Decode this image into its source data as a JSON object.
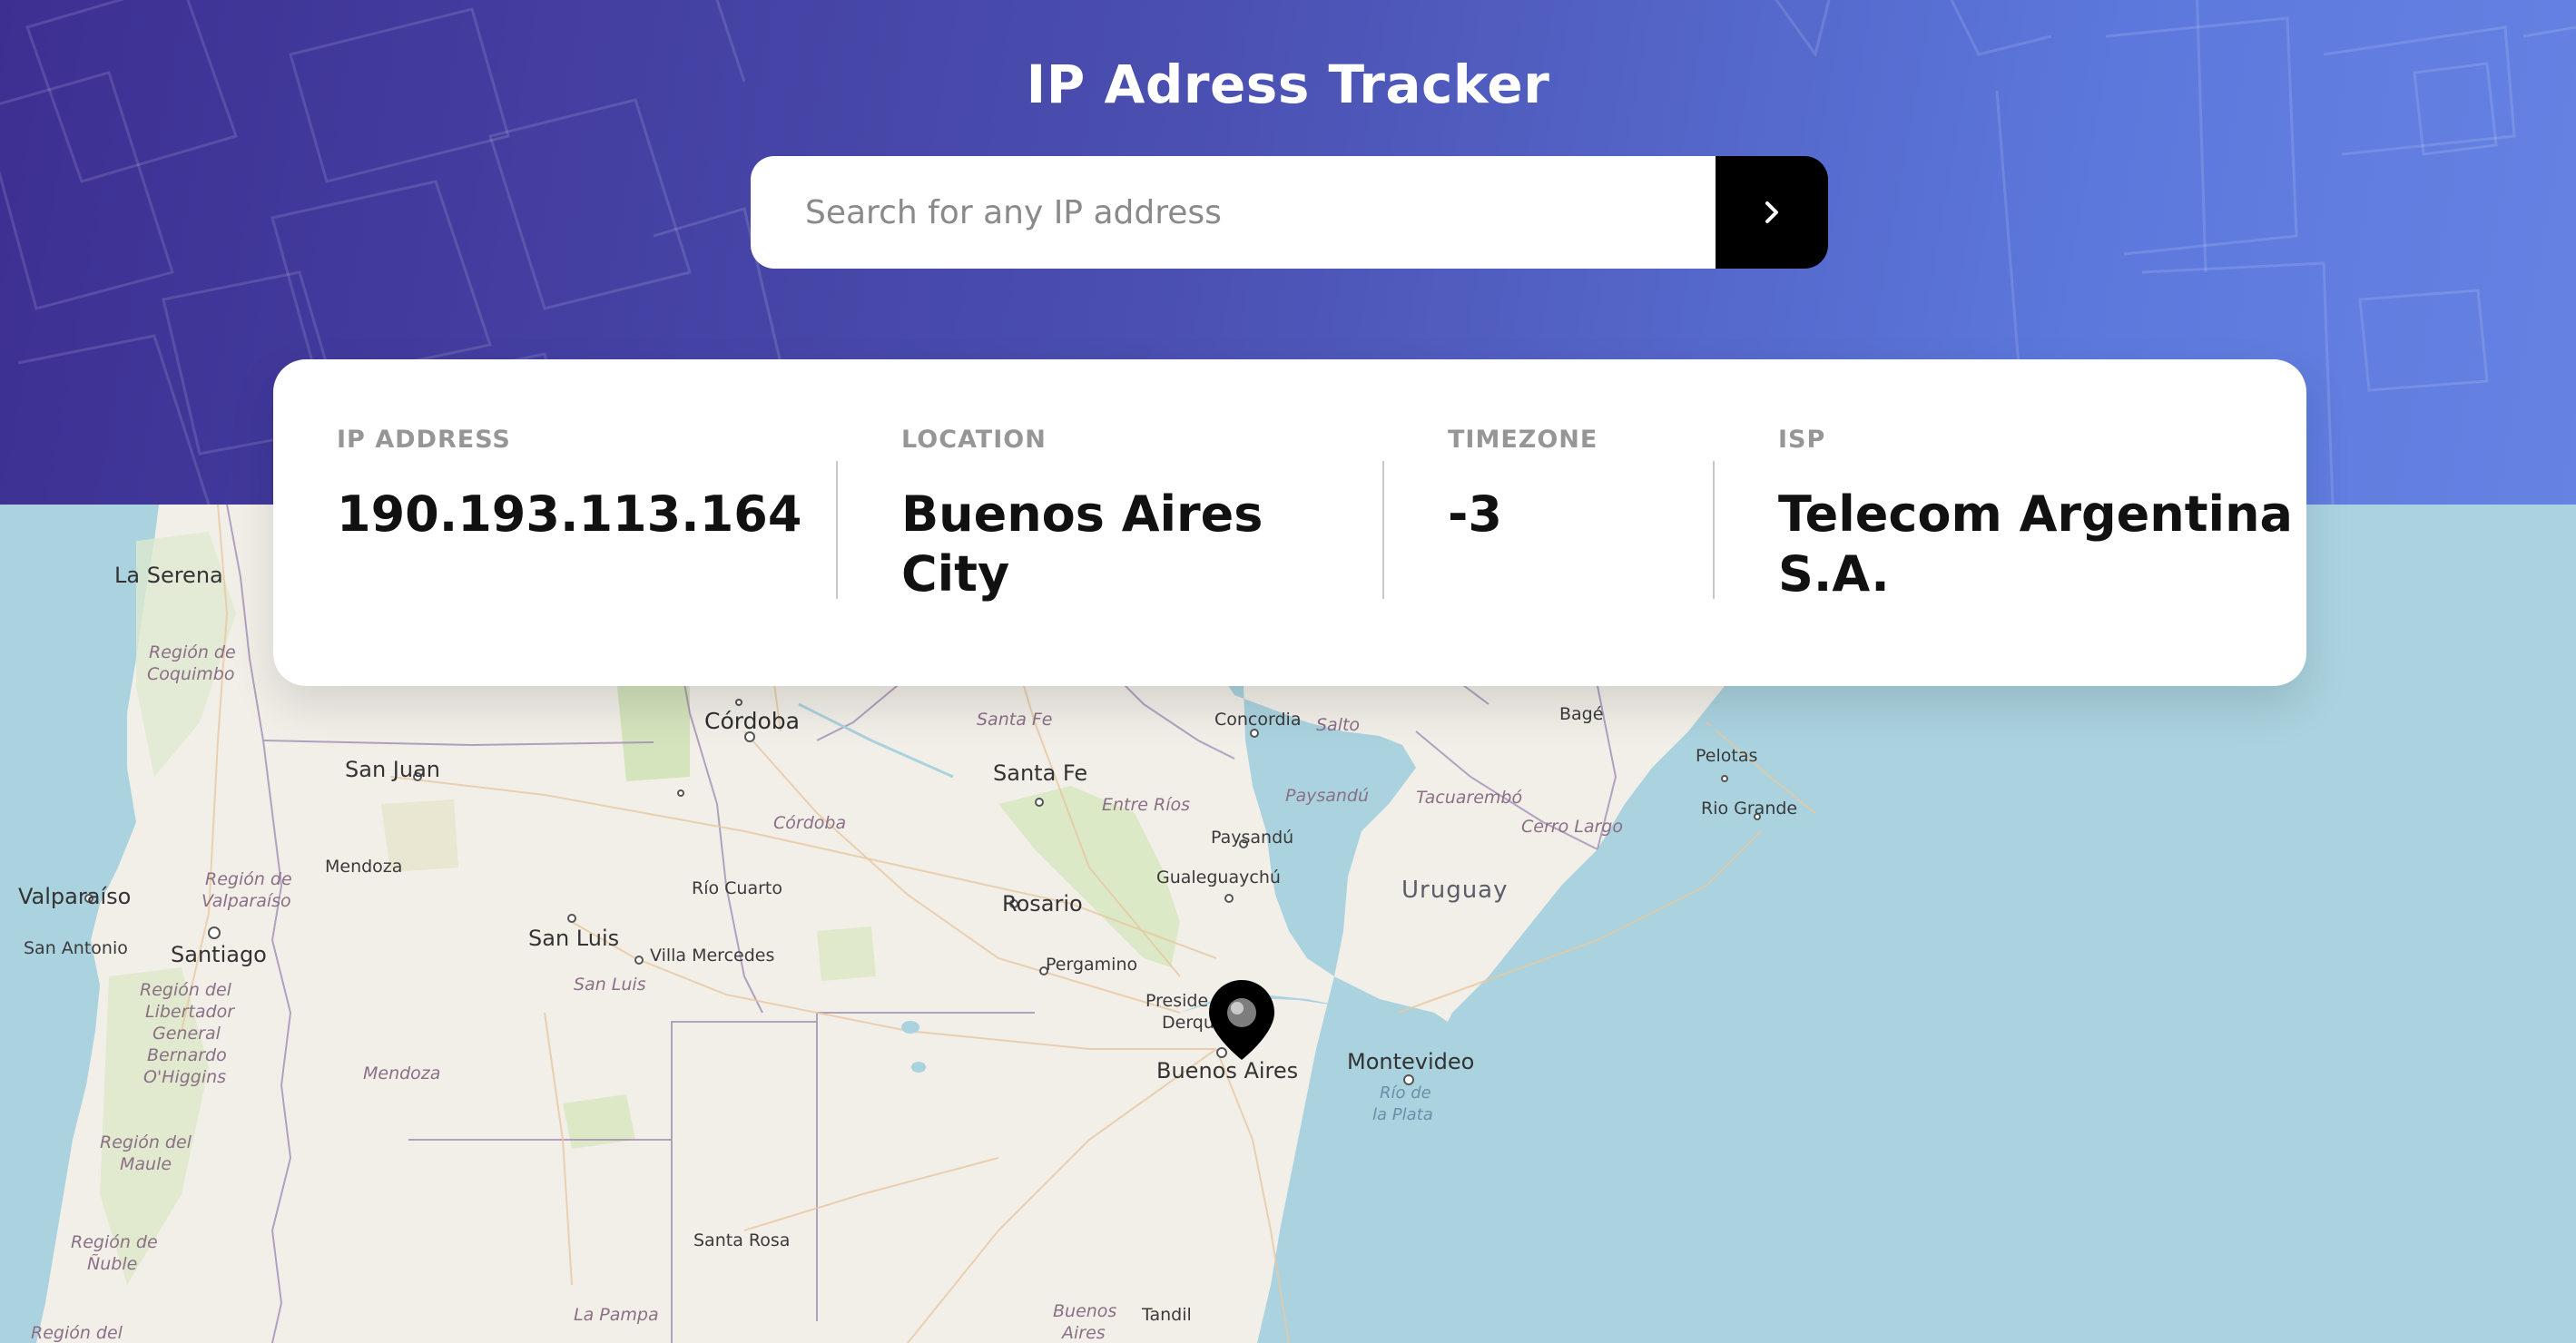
{
  "header": {
    "title": "IP Adress Tracker"
  },
  "search": {
    "placeholder": "Search for any IP address",
    "value": "",
    "button_icon": "chevron-right-icon"
  },
  "info": {
    "ip_address": {
      "label": "IP ADDRESS",
      "value": "190.193.113.164"
    },
    "location": {
      "label": "LOCATION",
      "value_line1": "Buenos Aires",
      "value_line2": "City"
    },
    "timezone": {
      "label": "TIMEZONE",
      "value": "-3"
    },
    "isp": {
      "label": "ISP",
      "value_line1": "Telecom Argentina",
      "value_line2": "S.A."
    }
  },
  "map": {
    "marker_icon": "location-pin-icon",
    "labels": {
      "la_serena": "La Serena",
      "region_coquimbo_1": "Región de",
      "region_coquimbo_2": "Coquimbo",
      "cordoba_city": "Córdoba",
      "santa_fe_region": "Santa Fe",
      "concordia": "Concordia",
      "salto": "Salto",
      "bage": "Bagé",
      "pelotas": "Pelotas",
      "rio_grande": "Rio Grande",
      "san_juan": "San Juan",
      "santa_fe_city": "Santa Fe",
      "entre_rios": "Entre Ríos",
      "paysandu_region": "Paysandú",
      "tacuarembo": "Tacuarembó",
      "cerro_largo": "Cerro Largo",
      "cordoba_region": "Córdoba",
      "paysandu_city": "Paysandú",
      "mendoza_city": "Mendoza",
      "valparaiso": "Valparaíso",
      "region_valparaiso_1": "Región de",
      "region_valparaiso_2": "Valparaíso",
      "rio_cuarto": "Río Cuarto",
      "rosario": "Rosario",
      "gualeguaychu": "Gualeguaychú",
      "uruguay": "Uruguay",
      "san_antonio": "San Antonio",
      "santiago": "Santiago",
      "san_luis_city": "San Luis",
      "villa_mercedes": "Villa Mercedes",
      "pergamino": "Pergamino",
      "region_libertador_1": "Región del",
      "region_libertador_2": "Libertador",
      "region_libertador_3": "General",
      "region_libertador_4": "Bernardo",
      "region_libertador_5": "O'Higgins",
      "san_luis_region": "San Luis",
      "presidente_derqui_1": "Preside",
      "presidente_derqui_2": "Derqu",
      "buenos_aires_city": "Buenos Aires",
      "montevideo": "Montevideo",
      "rio_de_la_plata_1": "Río de",
      "rio_de_la_plata_2": "la Plata",
      "mendoza_region": "Mendoza",
      "region_maule_1": "Región del",
      "region_maule_2": "Maule",
      "region_nuble_1": "Región de",
      "region_nuble_2": "Ñuble",
      "santa_rosa": "Santa Rosa",
      "la_pampa": "La Pampa",
      "buenos_aires_region_1": "Buenos",
      "buenos_aires_region_2": "Aires",
      "tandil": "Tandil",
      "region_del": "Región del"
    }
  },
  "colors": {
    "header_gradient_start": "#3d2f92",
    "header_gradient_end": "#6583e3",
    "ocean": "#aad3df",
    "land": "#f2efe9",
    "button": "#000000"
  }
}
